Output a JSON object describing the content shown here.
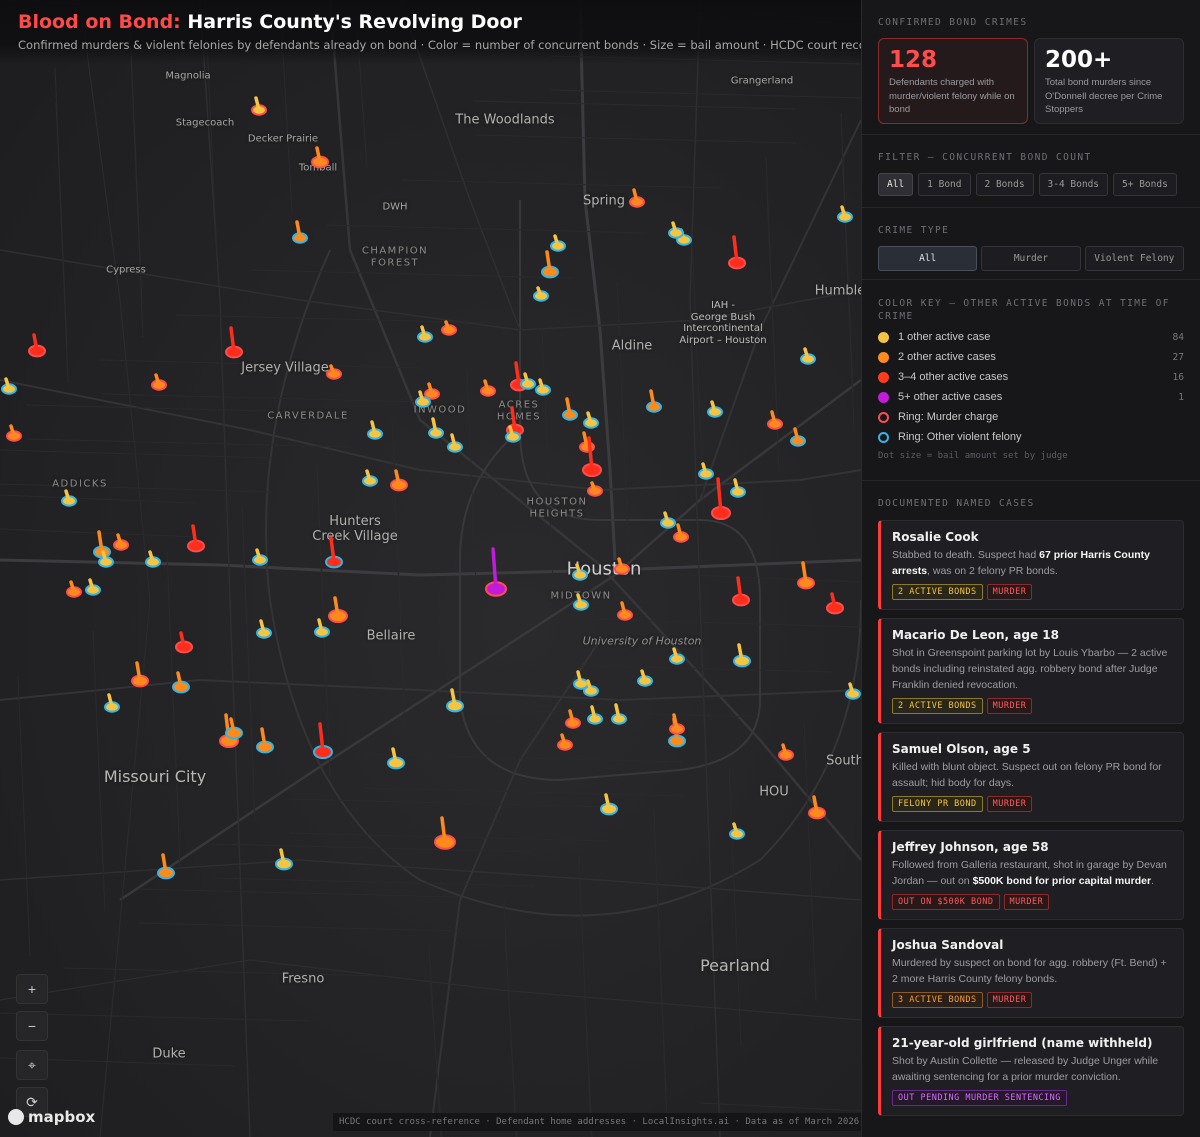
{
  "header": {
    "title_accent": "Blood on Bond:",
    "title_rest": " Harris County's Revolving Door",
    "subtitle": "Confirmed murders & violent felonies by defendants already on bond · Color = number of concurrent bonds · Size = bail amount · HCDC court records"
  },
  "map": {
    "places": [
      {
        "name": "Magnolia",
        "size": "sm"
      },
      {
        "name": "Grangerland",
        "size": "sm"
      },
      {
        "name": "Stagecoach",
        "size": "sm"
      },
      {
        "name": "Decker Prairie",
        "size": "sm"
      },
      {
        "name": "The Woodlands",
        "size": "md"
      },
      {
        "name": "Tomball",
        "size": "sm"
      },
      {
        "name": "DWH",
        "size": "sm"
      },
      {
        "name": "Spring",
        "size": "md"
      },
      {
        "name": "CHAMPION\nFOREST",
        "size": "caps"
      },
      {
        "name": "Cypress",
        "size": "sm"
      },
      {
        "name": "IAH -\nGeorge Bush\nIntercontinental\nAirport – Houston",
        "size": "wrap"
      },
      {
        "name": "Humble",
        "size": "md"
      },
      {
        "name": "Aldine",
        "size": "md"
      },
      {
        "name": "Jersey Village",
        "size": "md"
      },
      {
        "name": "CARVERDALE",
        "size": "caps"
      },
      {
        "name": "INWOOD",
        "size": "caps"
      },
      {
        "name": "ACRES\nHOMES",
        "size": "caps"
      },
      {
        "name": "ADDICKS",
        "size": "caps"
      },
      {
        "name": "HOUSTON\nHEIGHTS",
        "size": "caps"
      },
      {
        "name": "Hunters\nCreek Village",
        "size": "md"
      },
      {
        "name": "Houston",
        "size": "xl"
      },
      {
        "name": "MIDTOWN",
        "size": "caps"
      },
      {
        "name": "University of Houston",
        "size": "ital"
      },
      {
        "name": "Bellaire",
        "size": "md"
      },
      {
        "name": "Missouri City",
        "size": "lg"
      },
      {
        "name": "South",
        "size": "md"
      },
      {
        "name": "HOU",
        "size": "md"
      },
      {
        "name": "Pearland",
        "size": "lg"
      },
      {
        "name": "Fresno",
        "size": "md"
      },
      {
        "name": "Duke",
        "size": "md"
      }
    ],
    "markers": [
      {
        "color": "yellow",
        "ring": "other",
        "bail": "low"
      },
      {
        "color": "orange",
        "ring": "other",
        "bail": "mid"
      },
      {
        "color": "red",
        "ring": "murder",
        "bail": "high"
      },
      {
        "color": "purple",
        "ring": "murder",
        "bail": "high"
      }
    ],
    "controls": {
      "zoom_in": "+",
      "zoom_out": "−",
      "compass": "⌖",
      "locate": "⟳"
    },
    "attribution": "HCDC court cross-reference · Defendant home addresses · LocalInsights.ai · Data as of March 2026",
    "logo": "mapbox"
  },
  "sidebar": {
    "confirmed_title": "CONFIRMED BOND CRIMES",
    "stats": [
      {
        "value": "128",
        "label": "Defendants charged with murder/violent felony while on bond"
      },
      {
        "value": "200+",
        "label": "Total bond murders since O'Donnell decree per Crime Stoppers"
      }
    ],
    "filter_title": "FILTER — CONCURRENT BOND COUNT",
    "filters": [
      "All",
      "1 Bond",
      "2 Bonds",
      "3-4 Bonds",
      "5+ Bonds"
    ],
    "filter_active": "All",
    "crime_title": "CRIME TYPE",
    "crime_types": [
      "All",
      "Murder",
      "Violent Felony"
    ],
    "crime_active": "All",
    "key_title": "COLOR KEY — OTHER ACTIVE BONDS AT TIME OF CRIME",
    "key": [
      {
        "label": "1 other active case",
        "count": "84",
        "color": "#f5c542",
        "ring": false
      },
      {
        "label": "2 other active cases",
        "count": "27",
        "color": "#ff8a1c",
        "ring": false
      },
      {
        "label": "3–4 other active cases",
        "count": "16",
        "color": "#ff3b1c",
        "ring": false
      },
      {
        "label": "5+ other active cases",
        "count": "1",
        "color": "#c21bd9",
        "ring": false
      },
      {
        "label": "Ring: Murder charge",
        "count": "",
        "color": "#ff4d4d",
        "ring": true
      },
      {
        "label": "Ring: Other violent felony",
        "count": "",
        "color": "#33b5e5",
        "ring": true
      }
    ],
    "key_note": "Dot size = bail amount set by judge",
    "cases_title": "DOCUMENTED NAMED CASES",
    "cases": [
      {
        "name": "Rosalie Cook",
        "desc": [
          "Stabbed to death. Suspect had ",
          "67 prior Harris County arrests",
          ", was on 2 felony PR bonds."
        ],
        "tags": [
          {
            "text": "2 ACTIVE BONDS",
            "cls": "y"
          },
          {
            "text": "MURDER",
            "cls": "r"
          }
        ]
      },
      {
        "name": "Macario De Leon, age 18",
        "desc": [
          "Shot in Greenspoint parking lot by Louis Ybarbo — 2 active bonds including reinstated agg. robbery bond after Judge Franklin denied revocation.",
          "",
          ""
        ],
        "tags": [
          {
            "text": "2 ACTIVE BONDS",
            "cls": "y"
          },
          {
            "text": "MURDER",
            "cls": "r"
          }
        ]
      },
      {
        "name": "Samuel Olson, age 5",
        "desc": [
          "Killed with blunt object. Suspect out on felony PR bond for assault; hid body for days.",
          "",
          ""
        ],
        "tags": [
          {
            "text": "FELONY PR BOND",
            "cls": "y"
          },
          {
            "text": "MURDER",
            "cls": "r"
          }
        ]
      },
      {
        "name": "Jeffrey Johnson, age 58",
        "desc": [
          "Followed from Galleria restaurant, shot in garage by Devan Jordan — out on ",
          "$500K bond for prior capital murder",
          "."
        ],
        "tags": [
          {
            "text": "OUT ON $500K BOND",
            "cls": "r"
          },
          {
            "text": "MURDER",
            "cls": "r"
          }
        ]
      },
      {
        "name": "Joshua Sandoval",
        "desc": [
          "Murdered by suspect on bond for agg. robbery (Ft. Bend) + 2 more Harris County felony bonds.",
          "",
          ""
        ],
        "tags": [
          {
            "text": "3 ACTIVE BONDS",
            "cls": "o"
          },
          {
            "text": "MURDER",
            "cls": "r"
          }
        ]
      },
      {
        "name": "21-year-old girlfriend (name withheld)",
        "desc": [
          "Shot by Austin Collette — released by Judge Unger while awaiting sentencing for a prior murder conviction.",
          "",
          ""
        ],
        "tags": [
          {
            "text": "OUT PENDING MURDER SENTENCING",
            "cls": "p"
          }
        ]
      }
    ]
  }
}
